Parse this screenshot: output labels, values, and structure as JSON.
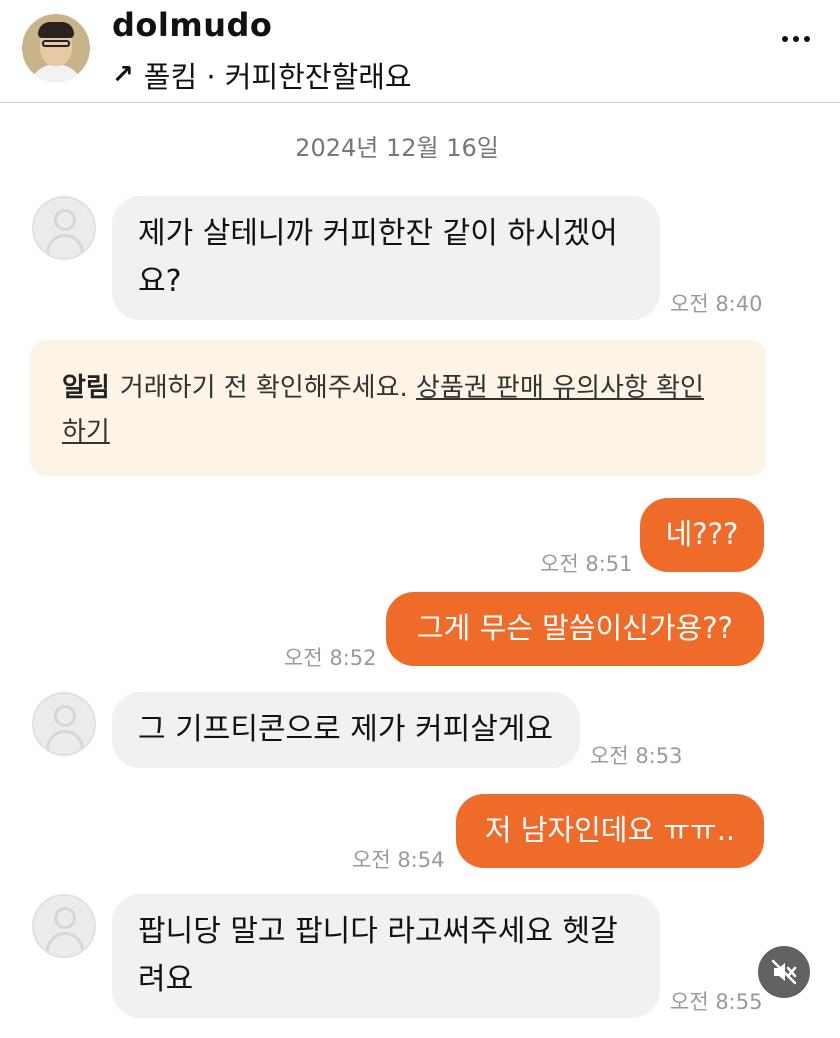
{
  "post": {
    "username": "dolmudo",
    "arrow": "↗",
    "subtitle": "폴킴 · 커피한잔할래요",
    "more_icon": "more-dots-icon"
  },
  "chat": {
    "date": "2024년 12월 16일",
    "messages": [
      {
        "side": "in",
        "text": "제가 살테니까 커피한잔 같이 하시겠어요?",
        "line1": "제가 살테니까 커피한잔 같이 하시겠어",
        "line2": "요?",
        "time": "오전 8:40"
      },
      {
        "side": "out",
        "text": "네???",
        "time": "오전 8:51"
      },
      {
        "side": "out",
        "text": "그게 무슨 말씀이신가용??",
        "time": "오전 8:52"
      },
      {
        "side": "in",
        "text": "그 기프티콘으로 제가 커피살게요",
        "time": "오전 8:53"
      },
      {
        "side": "out",
        "text": "저 남자인데요 ㅠㅠ..",
        "time": "오전 8:54"
      },
      {
        "side": "in",
        "text": "팝니당 말고 팝니다 라고써주세요 헷갈려요",
        "line1": "팝니당 말고 팝니다 라고써주세요 헷갈",
        "line2": "려요",
        "time": "오전 8:55"
      }
    ],
    "notice": {
      "tag": "알림",
      "text": "거래하기 전 확인해주세요. ",
      "link": "상품권 판매 유의사항 확인하기",
      "link_line1": "상품권 판매 유의사항 확인",
      "link_line2": "하기"
    }
  },
  "colors": {
    "outgoing_bubble": "#ef6b2a",
    "incoming_bubble": "#f1f1f3",
    "notice_bg": "#fdf4e6"
  },
  "mute_icon": "speaker-muted-icon"
}
